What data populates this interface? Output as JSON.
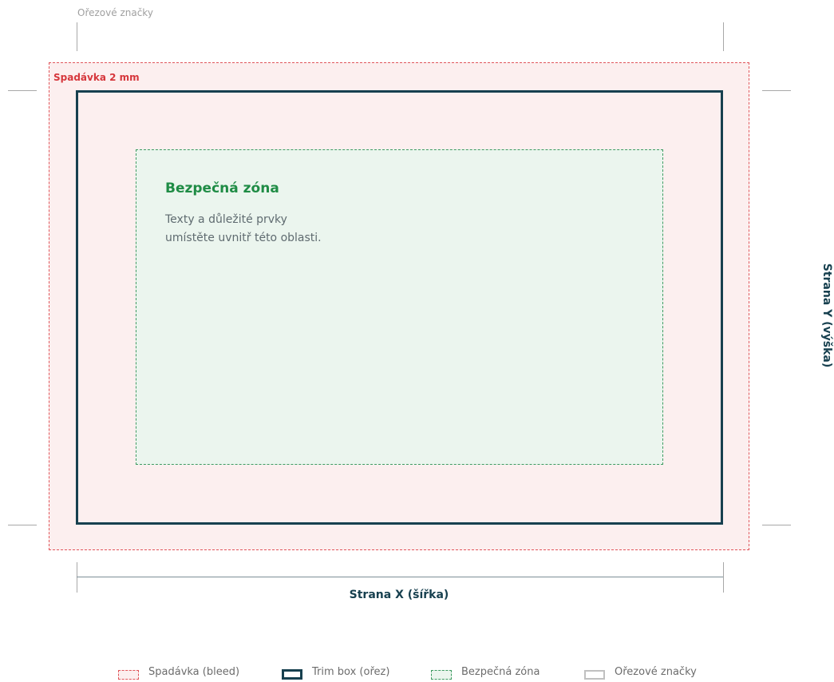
{
  "crop_marks_caption": "Ořezové značky",
  "bleed": {
    "label": "Spadávka 2 mm",
    "color": "#d6373c",
    "fill": "#fcefef"
  },
  "trim": {
    "color": "#17404f"
  },
  "safe_zone": {
    "title": "Bezpečná zóna",
    "description_lines": [
      "Texty a důležité prvky",
      "umístěte uvnitř této oblasti."
    ],
    "color": "#1f8c45",
    "fill": "#ebf5ee"
  },
  "dimensions": {
    "x_label": "Strana X (šířka)",
    "y_label": "Strana Y (výška)"
  },
  "legend": [
    {
      "label": "Spadávka (bleed)",
      "icon": "bleed-swatch"
    },
    {
      "label": "Trim box (ořez)",
      "icon": "trim-swatch"
    },
    {
      "label": "Bezpečná zóna",
      "icon": "safe-zone-swatch"
    },
    {
      "label": "Ořezové značky",
      "icon": "crop-mark-swatch"
    }
  ]
}
